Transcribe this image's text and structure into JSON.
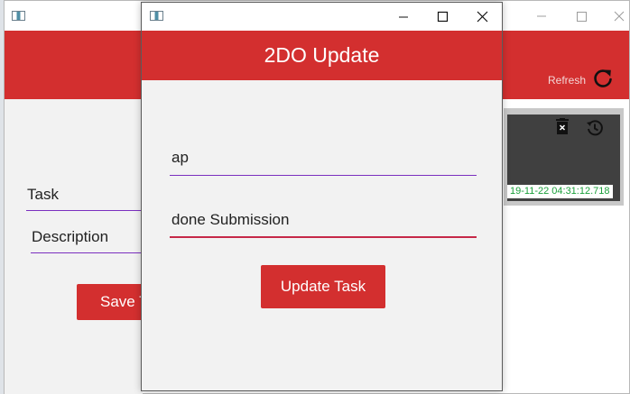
{
  "background_window": {
    "caption": {
      "minimize": "—",
      "maximize": "☐",
      "close": "✕"
    },
    "header": {
      "refresh_label": "Refresh"
    },
    "form": {
      "task_label": "Task",
      "description_label": "Description",
      "save_button_label": "Save Task"
    },
    "list": {
      "cards": [
        {
          "date": "19-11-22 04:31:12.718"
        }
      ]
    }
  },
  "dialog": {
    "title": "2DO Update",
    "task_value": "ap",
    "description_value": "done Submission",
    "update_button_label": "Update Task"
  },
  "icons": {
    "app": "app-window-icon",
    "refresh": "refresh-icon",
    "delete": "trash-icon",
    "history": "history-icon",
    "minimize": "minimize-icon",
    "maximize": "maximize-icon",
    "close": "close-icon"
  },
  "colors": {
    "accent": "#d32f2f",
    "field_underline": "#7b2fbf",
    "field_underline_focused": "#c62848",
    "card_background": "#404040",
    "date_text": "#1a9f3a"
  }
}
